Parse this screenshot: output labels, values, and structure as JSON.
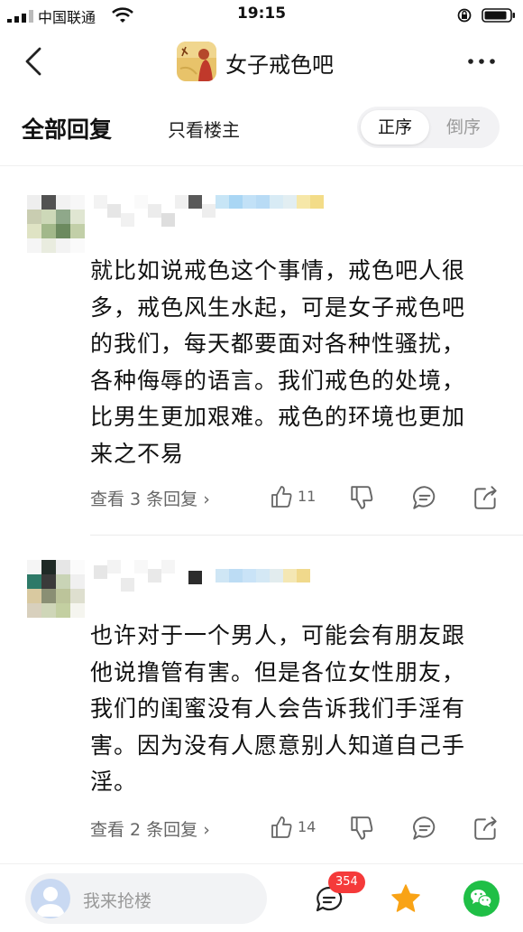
{
  "status_bar": {
    "carrier": "中国联通",
    "time": "19:15"
  },
  "nav": {
    "forum_name": "女子戒色吧"
  },
  "tabs": {
    "all_replies": "全部回复",
    "op_only": "只看楼主",
    "order_asc": "正序",
    "order_desc": "倒序"
  },
  "posts": [
    {
      "text": "就比如说戒色这个事情，戒色吧人很多，戒色风生水起，可是女子戒色吧的我们，每天都要面对各种性骚扰，各种侮辱的语言。我们戒色的处境，比男生更加艰难。戒色的环境也更加来之不易",
      "view_replies": "查看 3 条回复 ›",
      "likes": "11"
    },
    {
      "text": "也许对于一个男人，可能会有朋友跟他说撸管有害。但是各位女性朋友，我们的闺蜜没有人会告诉我们手淫有害。因为没有人愿意别人知道自己手淫。",
      "view_replies": "查看 2 条回复 ›",
      "likes": "14"
    }
  ],
  "bottom_bar": {
    "reply_placeholder": "我来抢楼",
    "comment_count": "354"
  },
  "colors": {
    "badge_red": "#f53a3a",
    "wechat_green": "#1fbf46",
    "star_orange": "#f9a316"
  }
}
